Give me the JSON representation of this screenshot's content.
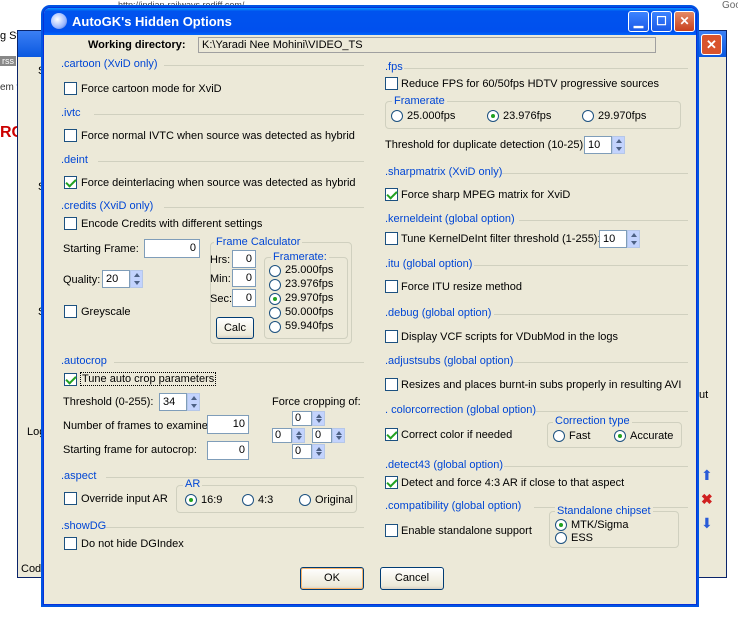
{
  "background": {
    "address_fragment": "http://indian-railways.rediff.com/...",
    "tab_fragment": "g Sta",
    "side_letters": [
      "S",
      "S",
      "S"
    ],
    "log_label": "Log",
    "code_label": "Code",
    "right_fragments": [
      "Goo",
      "ut"
    ],
    "left_fragments": [
      "RC",
      "em w",
      "rss"
    ]
  },
  "dialog": {
    "title": "AutoGK's Hidden Options",
    "working_dir_label": "Working directory:",
    "working_dir_value": "K:\\Yaradi Nee Mohini\\VIDEO_TS",
    "ok": "OK",
    "cancel": "Cancel"
  },
  "left": {
    "cartoon": {
      "title": ".cartoon (XviD only)",
      "label": "Force cartoon mode for XviD",
      "checked": false
    },
    "ivtc": {
      "title": ".ivtc",
      "label": "Force normal IVTC when source was detected as hybrid",
      "checked": false
    },
    "deint": {
      "title": ".deint",
      "label": "Force deinterlacing when source was detected as hybrid",
      "checked": true
    },
    "credits": {
      "title": ".credits (XviD only)",
      "encode_label": "Encode Credits with different settings",
      "starting_frame_label": "Starting Frame:",
      "starting_frame_value": "0",
      "quality_label": "Quality:",
      "quality_value": "20",
      "greyscale_label": "Greyscale",
      "calc": {
        "title": "Frame Calculator",
        "hrs_label": "Hrs:",
        "hrs_value": "0",
        "min_label": "Min:",
        "min_value": "0",
        "sec_label": "Sec:",
        "sec_value": "0",
        "calc_button": "Calc",
        "framerate_title": "Framerate:",
        "framerates": [
          "25.000fps",
          "23.976fps",
          "29.970fps",
          "50.000fps",
          "59.940fps"
        ],
        "selected": "29.970fps"
      }
    },
    "autocrop": {
      "title": ".autocrop",
      "tune_label": "Tune auto crop parameters",
      "tune_checked": true,
      "threshold_label": "Threshold (0-255):",
      "threshold_value": "34",
      "frames_label": "Number of frames to examine:",
      "frames_value": "10",
      "start_label": "Starting frame for autocrop:",
      "start_value": "0",
      "force_label": "Force cropping of:",
      "crop_top": "0",
      "crop_left": "0",
      "crop_right": "0",
      "crop_bottom": "0"
    },
    "aspect": {
      "title": ".aspect",
      "override_label": "Override input AR",
      "ar_title": "AR",
      "options": [
        "16:9",
        "4:3",
        "Original"
      ],
      "selected": "16:9"
    },
    "showdg": {
      "title": ".showDG",
      "label": "Do not hide DGIndex"
    }
  },
  "right": {
    "fps": {
      "title": ".fps",
      "reduce_label": "Reduce FPS for 60/50fps HDTV progressive sources",
      "framerate_title": "Framerate",
      "options": [
        "25.000fps",
        "23.976fps",
        "29.970fps"
      ],
      "selected": "23.976fps",
      "threshold_label": "Threshold for duplicate detection (10-25):",
      "threshold_value": "10"
    },
    "sharpmatrix": {
      "title": ".sharpmatrix (XviD only)",
      "label": "Force sharp MPEG matrix for XviD",
      "checked": true
    },
    "kerneldeint": {
      "title": ".kerneldeint (global option)",
      "label": "Tune KernelDeInt filter threshold (1-255):",
      "value": "10"
    },
    "itu": {
      "title": ".itu (global option)",
      "label": "Force ITU resize method"
    },
    "debug": {
      "title": ".debug (global option)",
      "label": "Display VCF scripts for VDubMod in the logs"
    },
    "adjustsubs": {
      "title": ".adjustsubs (global option)",
      "label": "Resizes and places burnt-in subs properly in resulting AVI"
    },
    "colorcorrection": {
      "title": ". colorcorrection (global option)",
      "label": "Correct color if needed",
      "checked": true,
      "type_title": "Correction type",
      "options": [
        "Fast",
        "Accurate"
      ],
      "selected": "Accurate"
    },
    "detect43": {
      "title": ".detect43 (global option)",
      "label": "Detect and force 4:3 AR if close to that aspect",
      "checked": true
    },
    "compatibility": {
      "title": ".compatibility (global option)",
      "label": "Enable standalone support",
      "chipset_title": "Standalone chipset",
      "options": [
        "MTK/Sigma",
        "ESS"
      ],
      "selected": "MTK/Sigma"
    }
  }
}
